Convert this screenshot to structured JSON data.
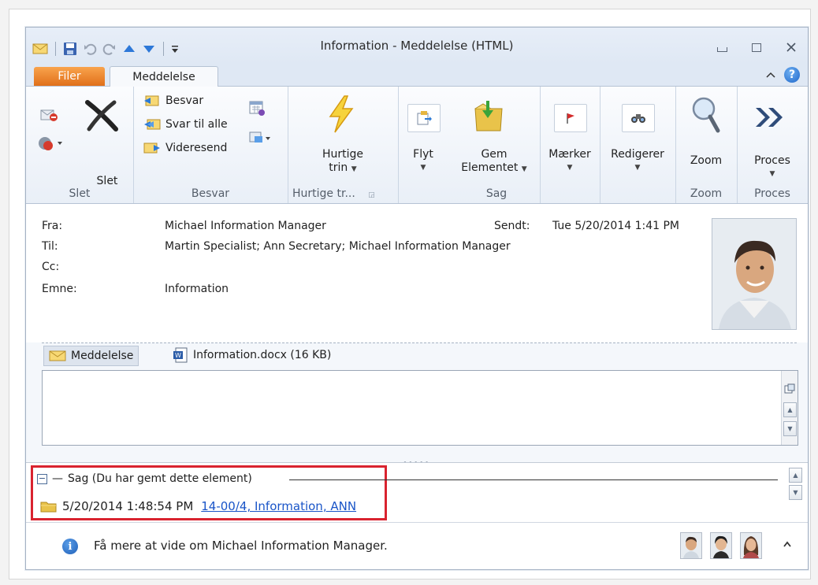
{
  "window": {
    "title": "Information  -  Meddelelse (HTML)"
  },
  "tabs": {
    "file": "Filer",
    "message": "Meddelelse"
  },
  "ribbon": {
    "groups": {
      "slet": "Slet",
      "besvar": "Besvar",
      "hurtige": "Hurtige tr...",
      "sag": "Sag",
      "zoom": "Zoom",
      "proces": "Proces"
    },
    "buttons": {
      "slet": "Slet",
      "besvar": "Besvar",
      "svar_til_alle": "Svar til alle",
      "videresend": "Videresend",
      "hurtige_line1": "Hurtige",
      "hurtige_line2": "trin",
      "flyt": "Flyt",
      "gem_line1": "Gem",
      "gem_line2": "Elementet",
      "maerker": "Mærker",
      "redigerer": "Redigerer",
      "zoom": "Zoom",
      "proces": "Proces"
    }
  },
  "header": {
    "from_label": "Fra:",
    "from_value": "Michael Information Manager",
    "to_label": "Til:",
    "to_value": "Martin Specialist; Ann Secretary; Michael Information Manager",
    "cc_label": "Cc:",
    "subject_label": "Emne:",
    "subject_value": "Information",
    "sent_label": "Sendt:",
    "sent_value": "Tue 5/20/2014 1:41 PM"
  },
  "attachments": {
    "message_tab": "Meddelelse",
    "file": "Information.docx (16 KB)"
  },
  "sag": {
    "title": "Sag (Du har gemt dette element)",
    "timestamp": "5/20/2014 1:48:54 PM",
    "link": "14-00/4, Information, ANN"
  },
  "infobar": {
    "text": "Få mere at vide om Michael Information Manager."
  },
  "colors": {
    "file_tab": "#e0701b",
    "highlight_box": "#d9232f",
    "link": "#1a55c8",
    "accent_blue": "#1e66c9"
  }
}
